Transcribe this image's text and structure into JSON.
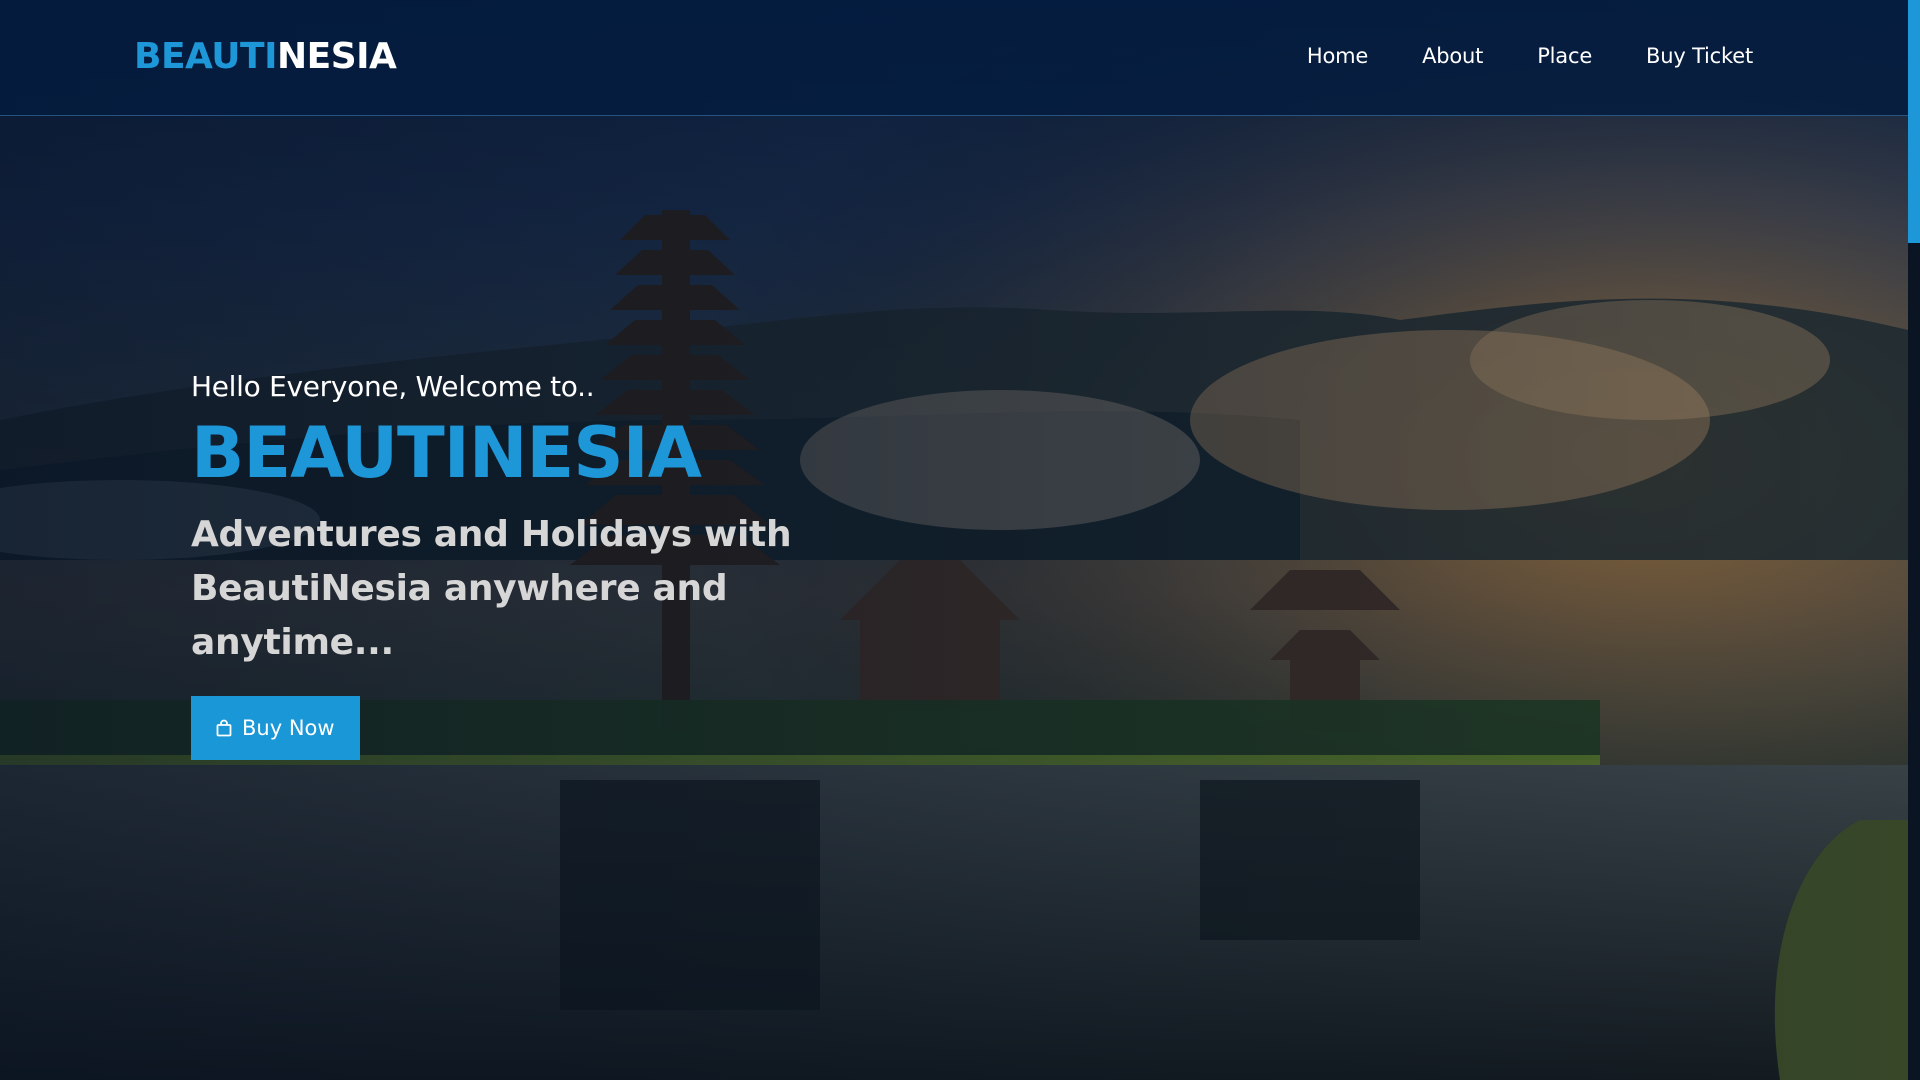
{
  "brand": {
    "logo_part1": "BEAUTI",
    "logo_part2": "NESIA",
    "accent_color": "#1d97d8"
  },
  "nav": {
    "items": [
      {
        "label": "Home"
      },
      {
        "label": "About"
      },
      {
        "label": "Place"
      },
      {
        "label": "Buy Ticket"
      }
    ]
  },
  "hero": {
    "greeting": "Hello Everyone, Welcome to..",
    "title": "BEAUTINESIA",
    "tagline": "Adventures and Holidays with BeautiNesia anywhere and anytime...",
    "cta_label": "Buy Now",
    "cta_icon": "shopping-bag-icon",
    "background": "temple-lake-landscape"
  }
}
